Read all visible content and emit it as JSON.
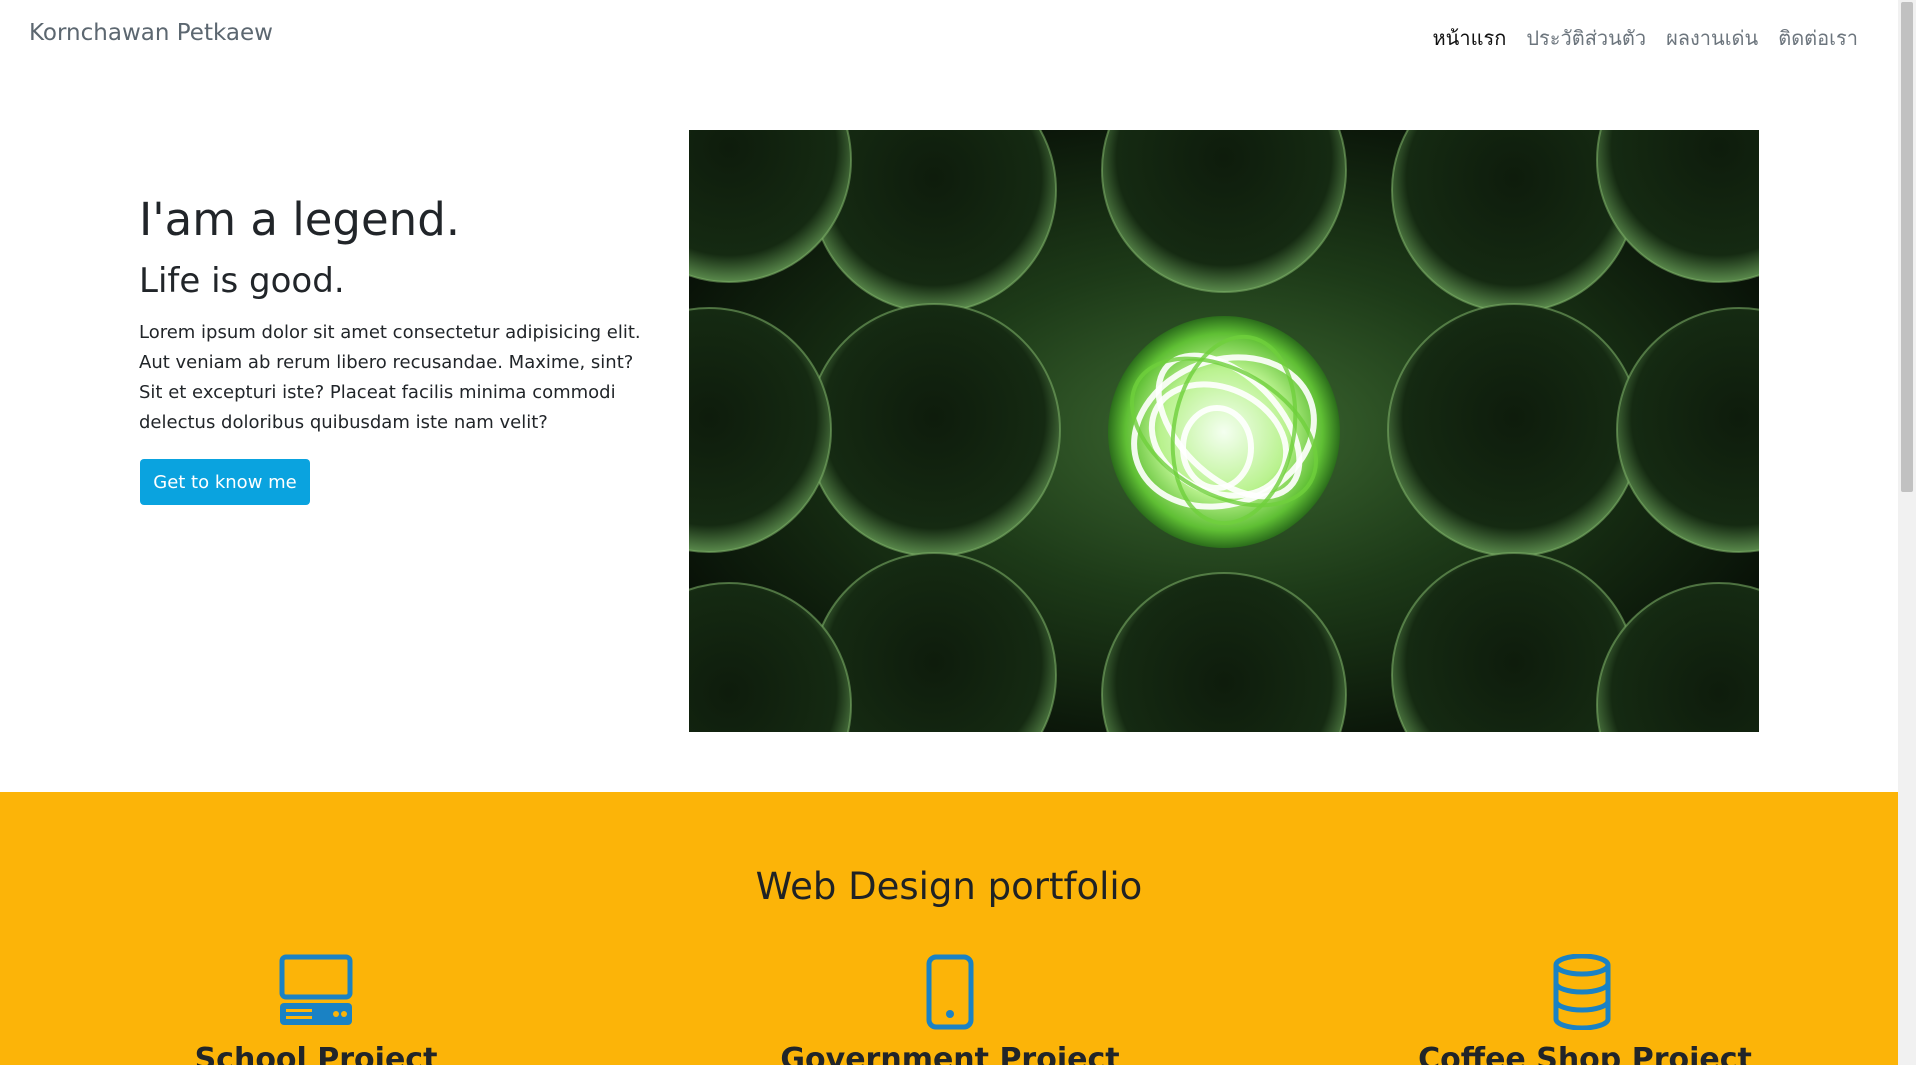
{
  "navbar": {
    "brand": "Kornchawan Petkaew",
    "links": [
      {
        "label": "หน้าแรก",
        "active": true
      },
      {
        "label": "ประวัติส่วนตัว",
        "active": false
      },
      {
        "label": "ผลงานเด่น",
        "active": false
      },
      {
        "label": "ติดต่อเรา",
        "active": false
      }
    ]
  },
  "hero": {
    "title": "I'am a legend.",
    "subtitle": "Life is good.",
    "body": "Lorem ipsum dolor sit amet consectetur adipisicing elit. Aut veniam ab rerum libero recusandae. Maxime, sint? Sit et excepturi iste? Placeat facilis minima commodi delectus doloribus quibusdam iste nam velit?",
    "cta_label": "Get to know me",
    "image_icon": "green-glass-spheres-image"
  },
  "portfolio": {
    "title": "Web Design portfolio",
    "items": [
      {
        "icon": "desktop-computer-icon",
        "title": "School Project"
      },
      {
        "icon": "mobile-phone-icon",
        "title": "Government Project"
      },
      {
        "icon": "database-icon",
        "title": "Coffee Shop Project"
      }
    ]
  },
  "colors": {
    "accent": "#0aa3df",
    "section_bg": "#fcb408",
    "icon": "#1a82c4"
  }
}
